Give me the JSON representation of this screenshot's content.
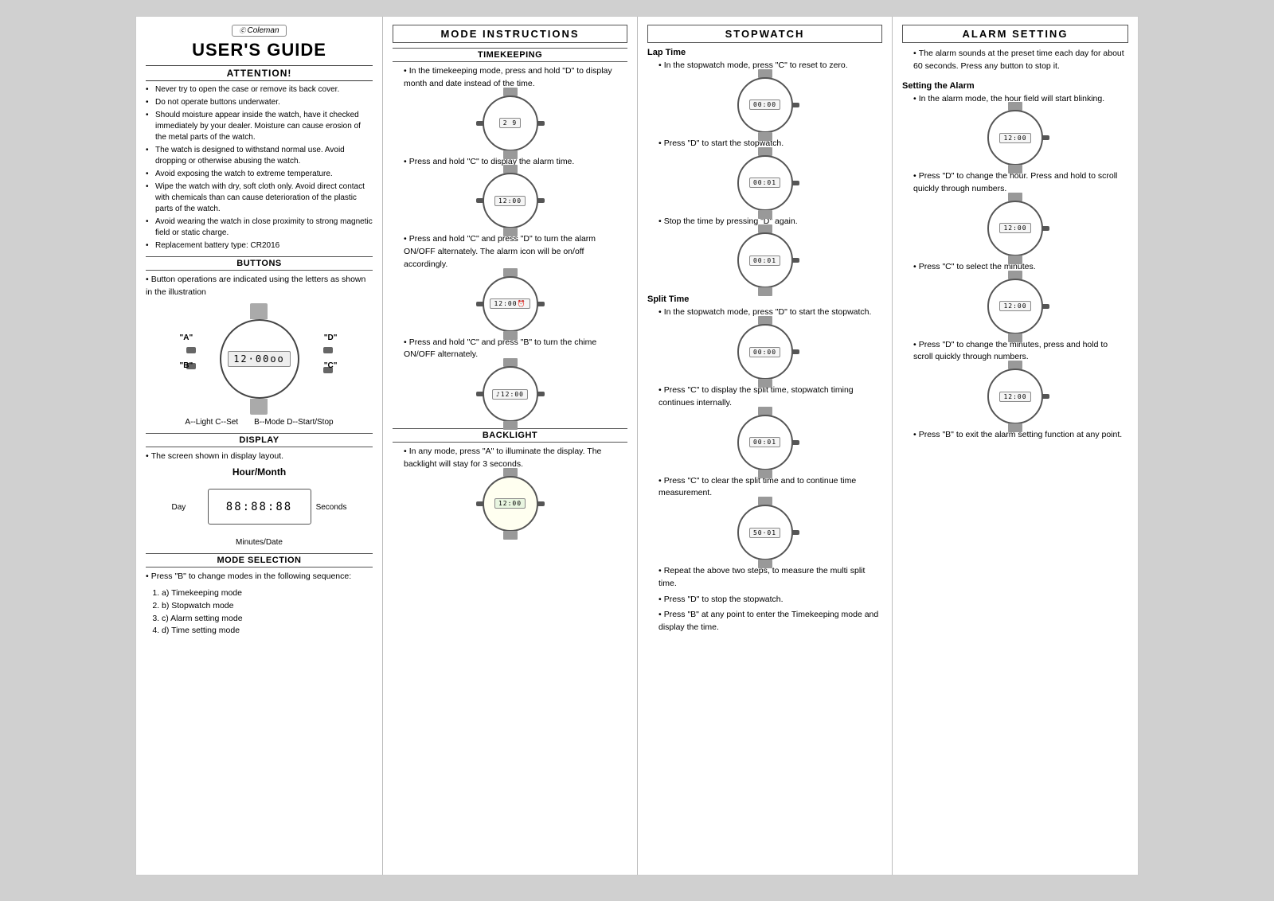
{
  "brand": "Coleman",
  "title": "USER'S GUIDE",
  "attention_title": "ATTENTION!",
  "attention_items": [
    "Never try to open the case or remove its back cover.",
    "Do not operate buttons underwater.",
    "Should moisture appear inside the watch, have it checked immediately by your dealer. Moisture can cause erosion of the metal parts of the watch.",
    "The watch is designed to withstand normal use. Avoid dropping or otherwise abusing the watch.",
    "Avoid exposing the watch to extreme temperature.",
    "Wipe the watch with dry, soft cloth only. Avoid direct contact with chemicals than can cause deterioration of the plastic parts of the watch.",
    "Avoid wearing the watch in close proximity to strong magnetic field or static charge.",
    "Replacement battery type: CR2016"
  ],
  "buttons_title": "BUTTONS",
  "buttons_desc": "Button operations are indicated using the letters as shown in the illustration",
  "button_labels": {
    "a": "\"A\"",
    "b": "\"B\"",
    "c": "\"C\"",
    "d": "\"D\""
  },
  "button_functions": [
    "A--Light    C--Set",
    "B--Mode    D--Start/Stop"
  ],
  "display_title": "DISPLAY",
  "display_desc": "The screen shown in display layout.",
  "display_labels": {
    "hour_month": "Hour/Month",
    "day": "Day",
    "seconds": "Seconds",
    "minutes_date": "Minutes/Date"
  },
  "display_value": "88:88:88",
  "mode_selection_title": "MODE SELECTION",
  "mode_selection_desc": "Press \"B\" to change modes in the following sequence:",
  "mode_items": [
    "a) Timekeeping mode",
    "b) Stopwatch mode",
    "c) Alarm setting mode",
    "d) Time setting mode"
  ],
  "col2_header": "MODE INSTRUCTIONS",
  "timekeeping_title": "TIMEKEEPING",
  "timekeeping_items": [
    "In the timekeeping mode, press and hold \"D\" to display month and date instead of the time.",
    "Press and hold \"C\" to display the alarm time.",
    "Press and hold \"C\" and press \"D\" to turn the alarm ON/OFF alternately. The alarm icon will be on/off accordingly.",
    "Press and hold \"C\" and press \"B\" to turn the chime ON/OFF alternately."
  ],
  "backlight_title": "BACKLIGHT",
  "backlight_desc": "In any mode, press \"A\" to illuminate the display. The backlight will stay for 3 seconds.",
  "col3_header": "STOPWATCH",
  "lap_time_title": "Lap Time",
  "lap_time_items": [
    "In the stopwatch mode, press \"C\" to  reset to zero.",
    "Press \"D\" to start the stopwatch.",
    "Stop the time by pressing \"D\" again."
  ],
  "split_time_title": "Split  Time",
  "split_time_items": [
    "In the stopwatch mode, press \"D\" to start the stopwatch.",
    "Press \"C\" to display the split time, stopwatch timing continues internally.",
    "Press \"C\" to clear the split time and to continue time measurement.",
    "Repeat the above two steps, to measure the multi split time.",
    "Press \"D\" to stop the stopwatch.",
    "Press \"B\" at any point to enter the Timekeeping mode and display the time."
  ],
  "col4_header": "ALARM SETTING",
  "alarm_setting_items": [
    "The alarm sounds at the preset time each day for about 60 seconds. Press any button to stop it.",
    "In the alarm mode, the hour field will start blinking.",
    "Press \"D\" to change the hour. Press and hold to scroll quickly through numbers.",
    "Press \"C\" to select the minutes.",
    "Press \"D\" to change the minutes, press and hold to scroll quickly through numbers.",
    "Press \"B\" to exit the alarm setting function at any point."
  ],
  "setting_alarm_subtitle": "Setting the Alarm",
  "watch_screens": {
    "timekeeping1": "2 9",
    "timekeeping2": "12:00",
    "stopwatch1": "00:00",
    "stopwatch2": "00:01",
    "stopwatch3": "00:01",
    "display_main": "12·00oo",
    "backlight": "12:00",
    "alarm1": "12:00",
    "alarm2": "12:00",
    "alarm3": "12:00",
    "alarm4": "12:00"
  }
}
